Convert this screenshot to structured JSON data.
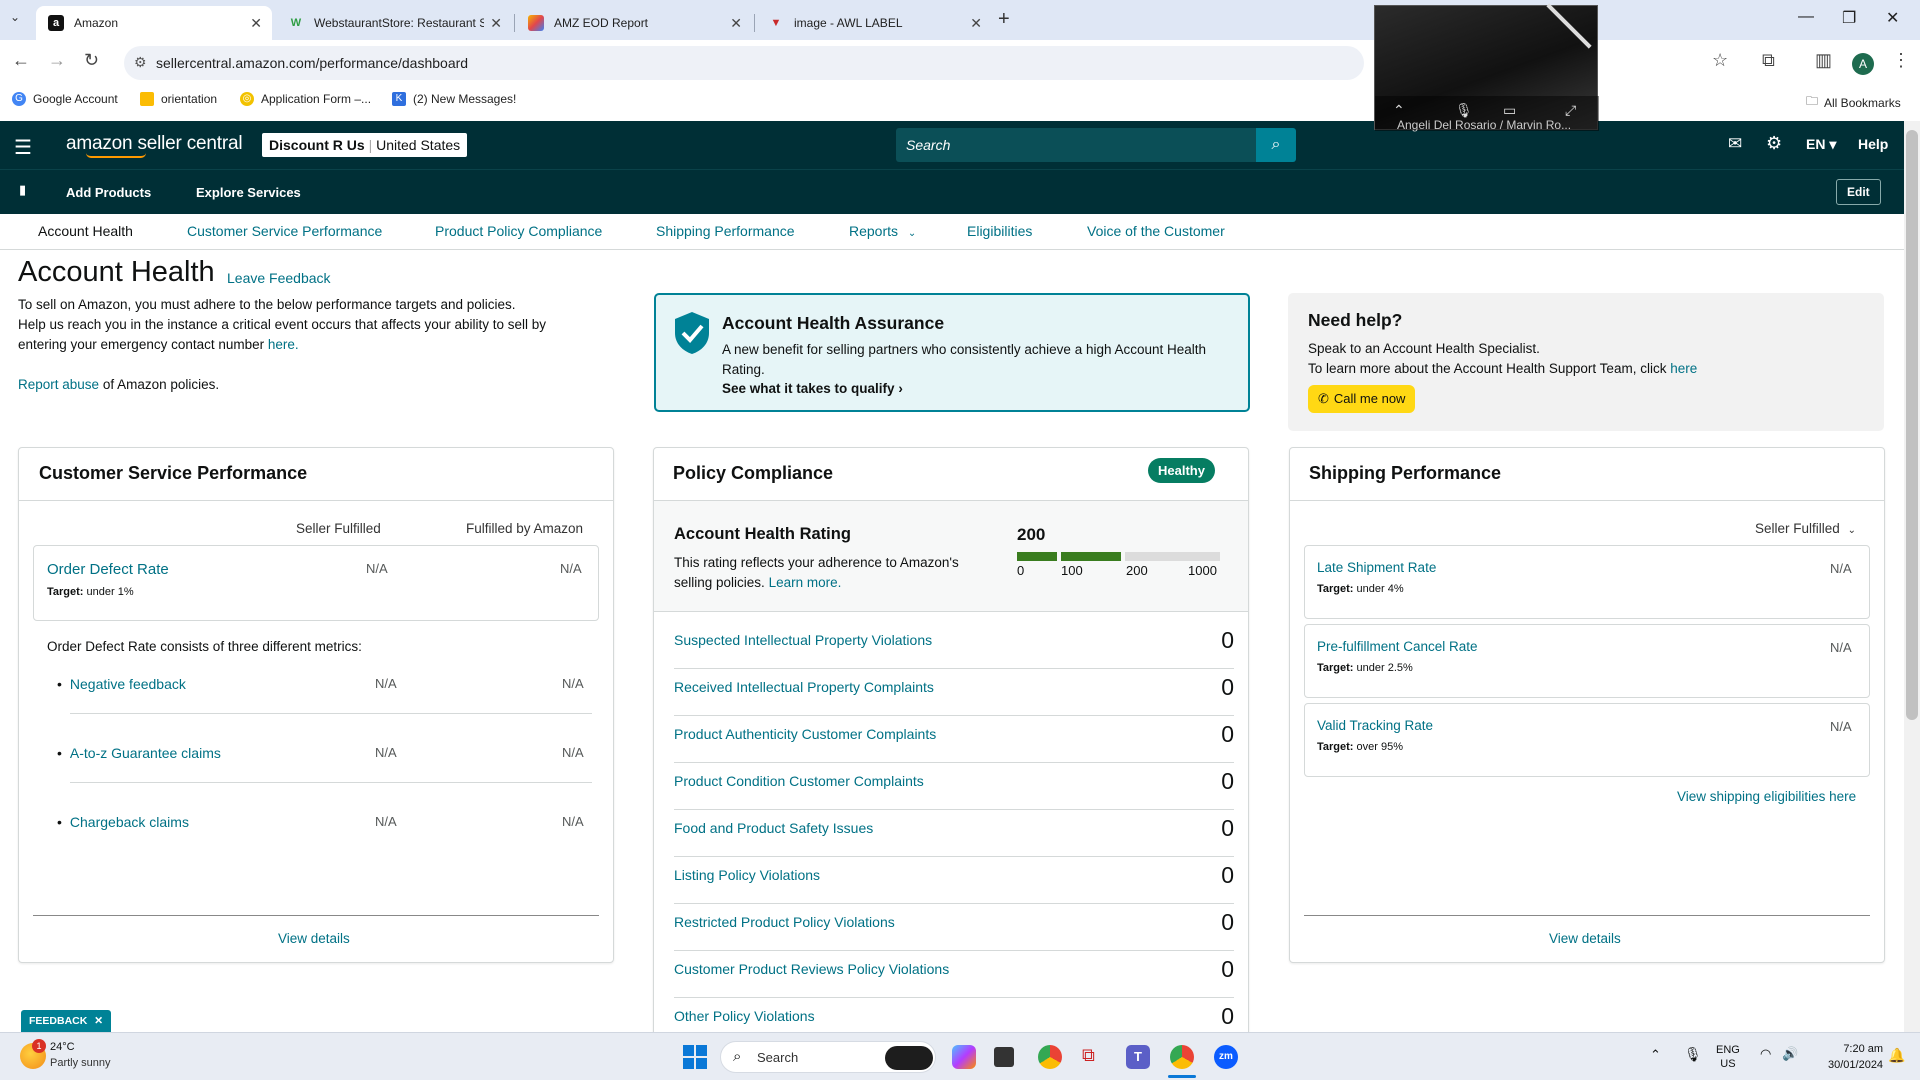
{
  "browser": {
    "tabs": [
      {
        "title": "Amazon"
      },
      {
        "title": "WebstaurantStore: Restaurant S"
      },
      {
        "title": "AMZ EOD Report"
      },
      {
        "title": "image - AWL LABEL"
      }
    ],
    "url": "sellercentral.amazon.com/performance/dashboard",
    "bookmarks": [
      "Google Account",
      "orientation",
      "Application Form –...",
      "(2) New Messages!"
    ],
    "all_bookmarks": "All Bookmarks",
    "profile_initial": "A",
    "video_overlay_caption": "Angeli Del Rosario / Marvin Ro..."
  },
  "seller_central": {
    "logo": "amazon seller central",
    "store": "Discount R Us",
    "region": "United States",
    "search_placeholder": "Search",
    "language": "EN",
    "help": "Help",
    "sub_nav": [
      "Add Products",
      "Explore Services"
    ],
    "edit": "Edit",
    "tabs": [
      "Account Health",
      "Customer Service Performance",
      "Product Policy Compliance",
      "Shipping Performance",
      "Reports",
      "Eligibilities",
      "Voice of the Customer"
    ]
  },
  "page": {
    "title": "Account Health",
    "leave_feedback": "Leave Feedback",
    "intro_line1": "To sell on Amazon, you must adhere to the below performance targets and policies.",
    "intro_line2": "Help us reach you in the instance a critical event occurs that affects your ability to sell by",
    "intro_line3": "entering your emergency contact number",
    "intro_here": "here.",
    "report_abuse": "Report abuse",
    "report_abuse_rest": "of Amazon policies."
  },
  "assurance": {
    "title": "Account Health Assurance",
    "body": "A new benefit for selling partners who consistently achieve a high Account Health Rating.",
    "cta": "See what it takes to qualify"
  },
  "help_box": {
    "title": "Need help?",
    "line1": "Speak to an Account Health Specialist.",
    "line2": "To learn more about the Account Health Support Team, click",
    "here": "here",
    "button": "Call me now"
  },
  "csp": {
    "title": "Customer Service Performance",
    "col1": "Seller Fulfilled",
    "col2": "Fulfilled by Amazon",
    "odr_label": "Order Defect Rate",
    "odr_target_label": "Target:",
    "odr_target": "under 1%",
    "odr_sf": "N/A",
    "odr_fba": "N/A",
    "consists": "Order Defect Rate consists of three different metrics:",
    "metrics": [
      {
        "label": "Negative feedback",
        "sf": "N/A",
        "fba": "N/A"
      },
      {
        "label": "A-to-z Guarantee claims",
        "sf": "N/A",
        "fba": "N/A"
      },
      {
        "label": "Chargeback claims",
        "sf": "N/A",
        "fba": "N/A"
      }
    ],
    "view_details": "View details"
  },
  "policy": {
    "title": "Policy Compliance",
    "status": "Healthy",
    "status_color": "#067d62",
    "ahr_label": "Account Health Rating",
    "ahr_value": "200",
    "ahr_desc1": "This rating reflects your adherence to Amazon's",
    "ahr_desc2": "selling policies.",
    "learn_more": "Learn more.",
    "scale": [
      "0",
      "100",
      "200",
      "1000"
    ],
    "items": [
      {
        "label": "Suspected Intellectual Property Violations",
        "count": "0"
      },
      {
        "label": "Received Intellectual Property Complaints",
        "count": "0"
      },
      {
        "label": "Product Authenticity Customer Complaints",
        "count": "0"
      },
      {
        "label": "Product Condition Customer Complaints",
        "count": "0"
      },
      {
        "label": "Food and Product Safety Issues",
        "count": "0"
      },
      {
        "label": "Listing Policy Violations",
        "count": "0"
      },
      {
        "label": "Restricted Product Policy Violations",
        "count": "0"
      },
      {
        "label": "Customer Product Reviews Policy Violations",
        "count": "0"
      },
      {
        "label": "Other Policy Violations",
        "count": "0"
      }
    ]
  },
  "shipping": {
    "title": "Shipping Performance",
    "filter": "Seller Fulfilled",
    "metrics": [
      {
        "label": "Late Shipment Rate",
        "target_label": "Target:",
        "target": "under 4%",
        "value": "N/A"
      },
      {
        "label": "Pre-fulfillment Cancel Rate",
        "target_label": "Target:",
        "target": "under 2.5%",
        "value": "N/A"
      },
      {
        "label": "Valid Tracking Rate",
        "target_label": "Target:",
        "target": "over 95%",
        "value": "N/A"
      }
    ],
    "eligibility_link": "View shipping eligibilities here",
    "view_details": "View details"
  },
  "feedback_tab": "FEEDBACK",
  "taskbar": {
    "weather_temp": "24°C",
    "weather_desc": "Partly sunny",
    "weather_badge": "1",
    "search": "Search",
    "lang1": "ENG",
    "lang2": "US",
    "time": "7:20 am",
    "date": "30/01/2024"
  }
}
